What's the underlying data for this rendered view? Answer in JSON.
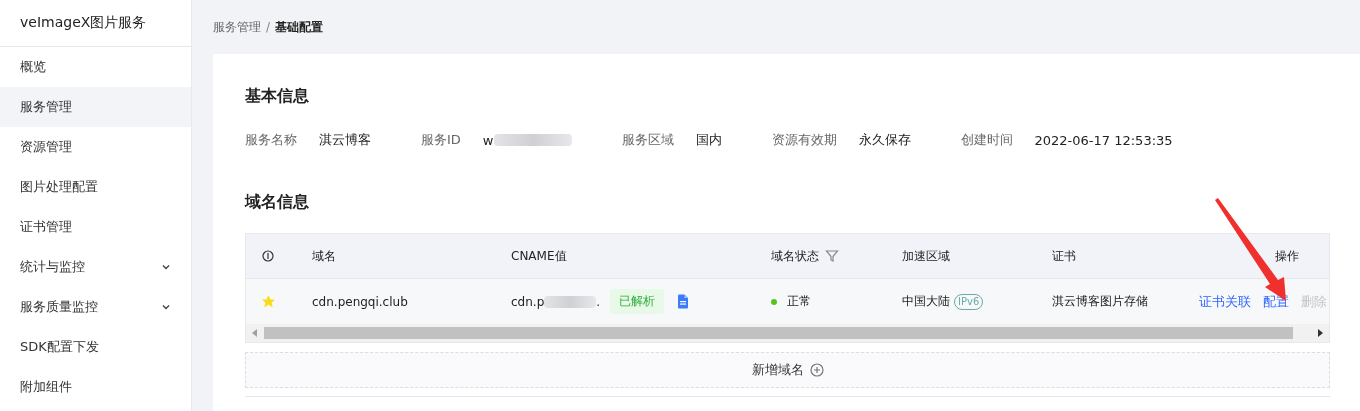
{
  "sidebar": {
    "title": "veImageX图片服务",
    "items": [
      {
        "label": "概览",
        "selected": false
      },
      {
        "label": "服务管理",
        "selected": true
      },
      {
        "label": "资源管理",
        "selected": false
      },
      {
        "label": "图片处理配置",
        "selected": false
      },
      {
        "label": "证书管理",
        "selected": false
      },
      {
        "label": "统计与监控",
        "selected": false,
        "expanded": false
      },
      {
        "label": "服务质量监控",
        "selected": false,
        "expanded": false
      },
      {
        "label": "SDK配置下发",
        "selected": false
      },
      {
        "label": "附加组件",
        "selected": false
      }
    ]
  },
  "breadcrumb": [
    "服务管理",
    "基础配置"
  ],
  "breadcrumb_separator": "/",
  "basic_info": {
    "title": "基本信息",
    "fields": [
      {
        "label": "服务名称",
        "value": "淇云博客"
      },
      {
        "label": "服务ID",
        "value": "w",
        "redacted": true
      },
      {
        "label": "服务区域",
        "value": "国内"
      },
      {
        "label": "资源有效期",
        "value": "永久保存"
      },
      {
        "label": "创建时间",
        "value": "2022-06-17 12:53:35"
      }
    ]
  },
  "domain_info": {
    "title": "域名信息",
    "table": {
      "columns": [
        "域名",
        "CNAME值",
        "域名状态",
        "加速区域",
        "证书",
        "操作"
      ],
      "rows": [
        {
          "starred": true,
          "domain": "cdn.pengqi.club",
          "cname": "cdn.p",
          "cname_end": ".",
          "cname_redacted": true,
          "resolve_tag": "已解析",
          "status": "正常",
          "color": "#52c41a",
          "region": "中国大陆",
          "region_tag": "IPv6",
          "certificate": "淇云博客图片存储",
          "actions": [
            {
              "label": "证书关联",
              "disabled": false
            },
            {
              "label": "配置",
              "disabled": false
            },
            {
              "label": "删除",
              "disabled": true
            }
          ]
        }
      ]
    },
    "add_button": "新增域名"
  }
}
